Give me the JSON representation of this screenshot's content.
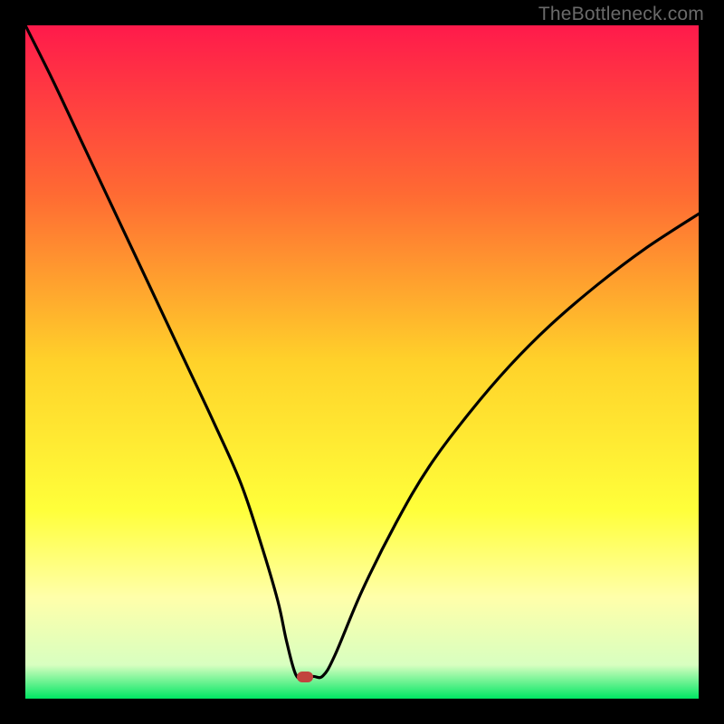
{
  "watermark": "TheBottleneck.com",
  "chart_data": {
    "type": "line",
    "title": "",
    "xlabel": "",
    "ylabel": "",
    "xlim": [
      0,
      100
    ],
    "ylim": [
      0,
      100
    ],
    "grid": false,
    "gradient_stops": [
      {
        "pct": 0,
        "color": "#ff1a4b"
      },
      {
        "pct": 25,
        "color": "#ff6a33"
      },
      {
        "pct": 50,
        "color": "#ffd22a"
      },
      {
        "pct": 72,
        "color": "#ffff3a"
      },
      {
        "pct": 85,
        "color": "#ffffaa"
      },
      {
        "pct": 95,
        "color": "#d8ffc0"
      },
      {
        "pct": 100,
        "color": "#00e663"
      }
    ],
    "series": [
      {
        "name": "bottleneck-curve",
        "x": [
          0,
          4,
          8,
          12,
          16,
          20,
          24,
          28,
          32,
          35,
          37.5,
          38.8,
          40.2,
          41.5,
          42.8,
          44.2,
          46,
          50,
          55,
          60,
          66,
          72,
          78,
          85,
          92,
          100
        ],
        "y": [
          100,
          92,
          83.5,
          75,
          66.5,
          58,
          49.5,
          41,
          32,
          23,
          14.5,
          8.5,
          3.5,
          3.2,
          3.3,
          3.4,
          6.5,
          16,
          26,
          34.5,
          42.5,
          49.5,
          55.5,
          61.5,
          66.8,
          72
        ]
      }
    ],
    "marker": {
      "x": 41.5,
      "y": 3.2,
      "color": "#c2433e"
    },
    "curve_min_flat": {
      "x_start": 40.2,
      "x_end": 44.2,
      "y": 3.3
    }
  }
}
